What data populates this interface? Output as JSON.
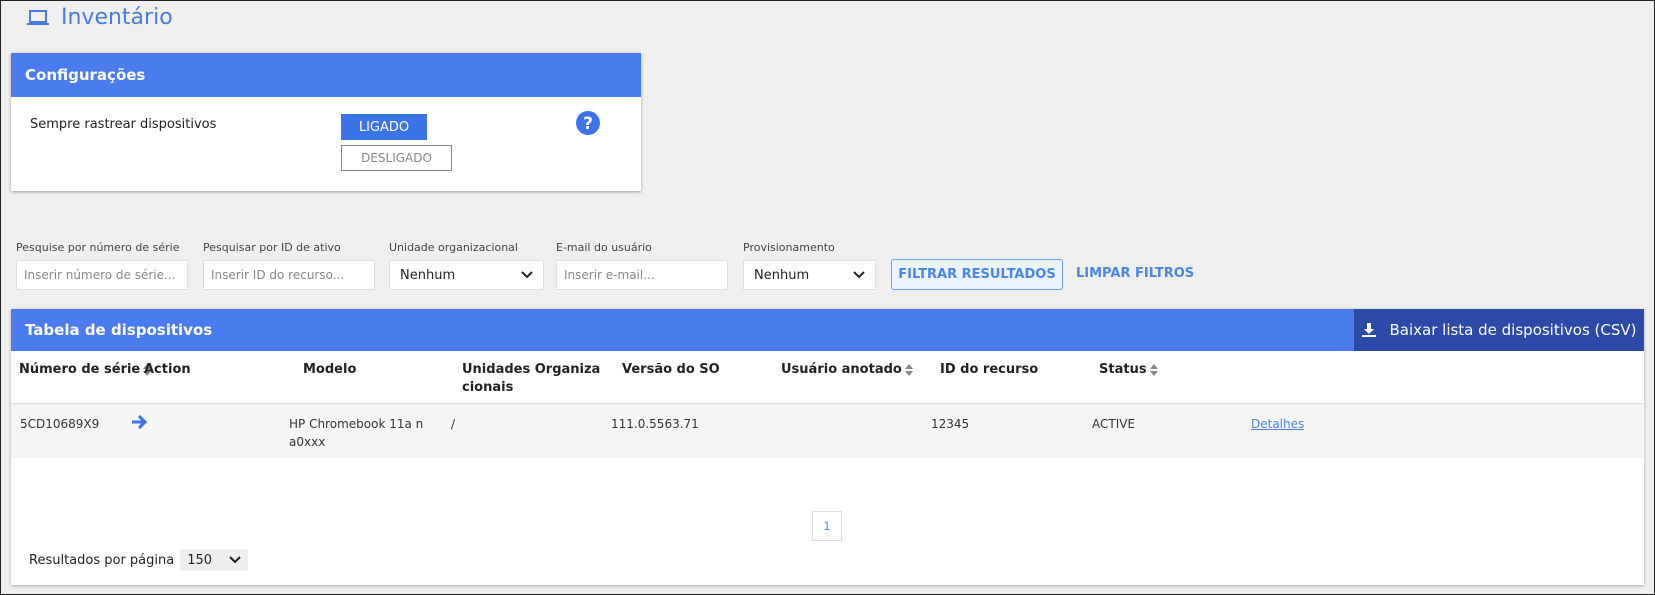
{
  "header": {
    "title": "Inventário",
    "icon": "laptop-icon"
  },
  "settings": {
    "title": "Configurações",
    "always_track_label": "Sempre rastrear dispositivos",
    "on_label": "LIGADO",
    "off_label": "DESLIGADO"
  },
  "filters": {
    "serial": {
      "label": "Pesquise por número de série",
      "placeholder": "Inserir número de série..."
    },
    "asset": {
      "label": "Pesquisar por ID de ativo",
      "placeholder": "Inserir ID do recurso..."
    },
    "org_unit": {
      "label": "Unidade organizacional",
      "value": "Nenhum"
    },
    "email": {
      "label": "E-mail do usuário",
      "placeholder": "Inserir e-mail..."
    },
    "provisioning": {
      "label": "Provisionamento",
      "value": "Nenhum"
    },
    "filter_button": "FILTRAR RESULTADOS",
    "clear_button": "LIMPAR FILTROS"
  },
  "table": {
    "title": "Tabela de dispositivos",
    "download_label": "Baixar lista de dispositivos (CSV)",
    "columns": [
      "Número de série",
      "Action",
      "Modelo",
      "Unidades Organizacionais",
      "Versão do SO",
      "Usuário anotado",
      "ID do recurso",
      "Status"
    ],
    "rows": [
      {
        "serial": "5CD10689X9",
        "model": "HP Chromebook 11a na0xxx",
        "org_unit": "/",
        "os_version": "111.0.5563.71",
        "user": "",
        "asset_id": "12345",
        "status": "ACTIVE",
        "details": "Detalhes"
      }
    ]
  },
  "pagination": {
    "current_page": "1",
    "per_page_label": "Resultados por página",
    "per_page_value": "150"
  },
  "colors": {
    "accent": "#4a7cf0",
    "dark_button": "#2c4aa8",
    "link": "#4a86e8"
  }
}
